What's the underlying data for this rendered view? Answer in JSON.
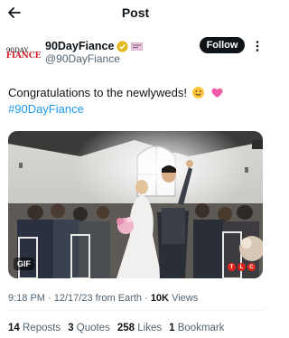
{
  "header": {
    "title": "Post",
    "back_icon": "arrow-left-icon"
  },
  "author": {
    "avatar_line1": "90DAY",
    "avatar_line2": "FIANCE",
    "display_name": "90DayFiance",
    "handle": "@90DayFiance",
    "follow_label": "Follow",
    "verified_color": "#e2b719"
  },
  "tweet": {
    "text": "Congratulations to the newlyweds!",
    "hashtag": "#90DayFiance"
  },
  "media": {
    "gif_label": "GIF",
    "logo_text": [
      "T",
      "L",
      "C"
    ]
  },
  "meta": {
    "time": "9:18 PM",
    "date": "12/17/23",
    "source": "from Earth",
    "views_count": "10K",
    "views_label": "Views"
  },
  "stats": {
    "reposts_count": "14",
    "reposts_label": "Reposts",
    "quotes_count": "3",
    "quotes_label": "Quotes",
    "likes_count": "258",
    "likes_label": "Likes",
    "bookmarks_count": "1",
    "bookmarks_label": "Bookmark"
  },
  "colors": {
    "link": "#1d9bf0",
    "text": "#0f1419",
    "muted": "#536471",
    "tlc_red": "#e2231a"
  }
}
